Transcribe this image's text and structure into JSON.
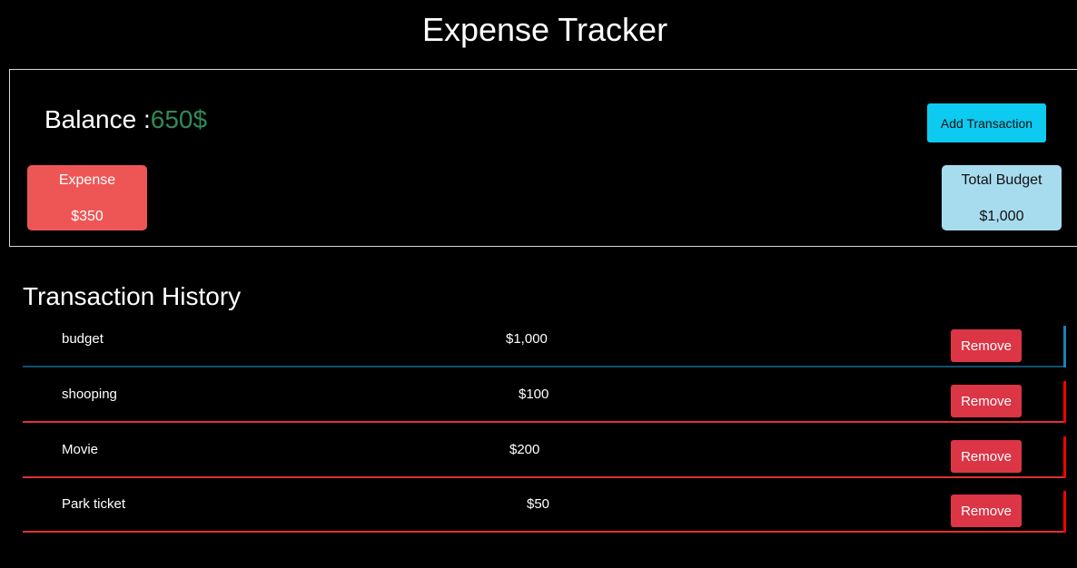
{
  "header": {
    "title": "Expense Tracker"
  },
  "summary": {
    "balance_label": "Balance :",
    "balance_value": "650$",
    "add_button_label": "Add Transaction",
    "expense": {
      "label": "Expense",
      "value": "$350"
    },
    "budget": {
      "label": "Total Budget",
      "value": "$1,000"
    }
  },
  "history": {
    "title": "Transaction History",
    "remove_label": "Remove",
    "items": [
      {
        "name": "budget",
        "amount": "$1,000",
        "type": "income"
      },
      {
        "name": "shooping",
        "amount": "$100",
        "type": "expense"
      },
      {
        "name": "Movie",
        "amount": "$200",
        "type": "expense"
      },
      {
        "name": "Park ticket",
        "amount": "$50",
        "type": "expense"
      }
    ]
  },
  "colors": {
    "balance_value": "#2e8b57",
    "add_button": "#0dcaf0",
    "expense_card": "#ee5656",
    "budget_card": "#a7dcef",
    "remove_button": "#dc3545",
    "income_accent": "#1f7fb0",
    "expense_accent": "#ff0000"
  }
}
